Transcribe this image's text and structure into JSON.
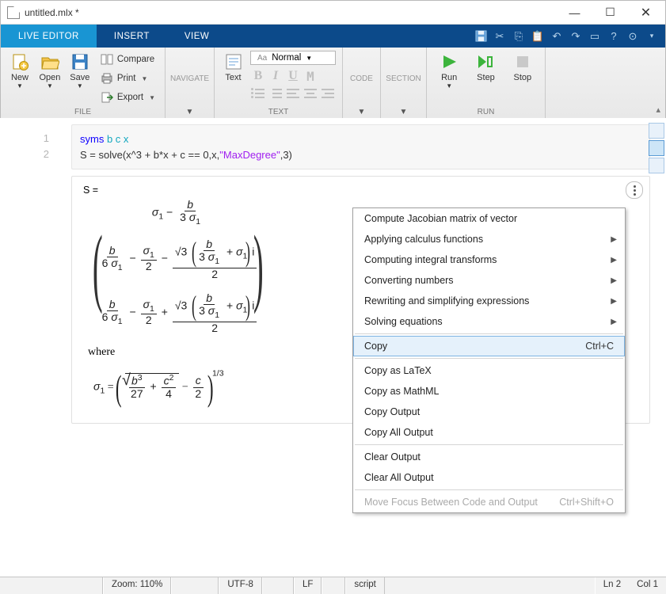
{
  "title": "untitled.mlx *",
  "tabs": {
    "live_editor": "LIVE EDITOR",
    "insert": "INSERT",
    "view": "VIEW"
  },
  "ribbon": {
    "file": {
      "new": "New",
      "open": "Open",
      "save": "Save",
      "compare": "Compare",
      "print": "Print",
      "export": "Export",
      "label": "FILE"
    },
    "navigate": {
      "label": "NAVIGATE"
    },
    "text": {
      "btn": "Text",
      "normal": "Normal",
      "label": "TEXT"
    },
    "code": {
      "code": "CODE",
      "section": "SECTION"
    },
    "run": {
      "run": "Run",
      "step": "Step",
      "stop": "Stop",
      "label": "RUN"
    }
  },
  "code": {
    "ln1": "1",
    "ln2": "2",
    "l1_kw": "syms",
    "l1_vars": " b c x",
    "l2a": "S = solve(x^3 + b*x + c == 0,x,",
    "l2s": "\"MaxDegree\"",
    "l2b": ",3)"
  },
  "output": {
    "head": "S =",
    "where": "where"
  },
  "menu": {
    "jacobian": "Compute Jacobian matrix of vector",
    "calculus": "Applying calculus functions",
    "integral": "Computing integral transforms",
    "convert": "Converting numbers",
    "rewrite": "Rewriting and simplifying expressions",
    "solving": "Solving equations",
    "copy": "Copy",
    "copy_sc": "Ctrl+C",
    "copy_latex": "Copy as LaTeX",
    "copy_mathml": "Copy as MathML",
    "copy_output": "Copy Output",
    "copy_all": "Copy All Output",
    "clear_output": "Clear Output",
    "clear_all": "Clear All Output",
    "move_focus": "Move Focus Between Code and Output",
    "move_focus_sc": "Ctrl+Shift+O"
  },
  "status": {
    "zoom": "Zoom: 110%",
    "encoding": "UTF-8",
    "eol": "LF",
    "type": "script",
    "ln": "Ln  2",
    "col": "Col  1"
  }
}
